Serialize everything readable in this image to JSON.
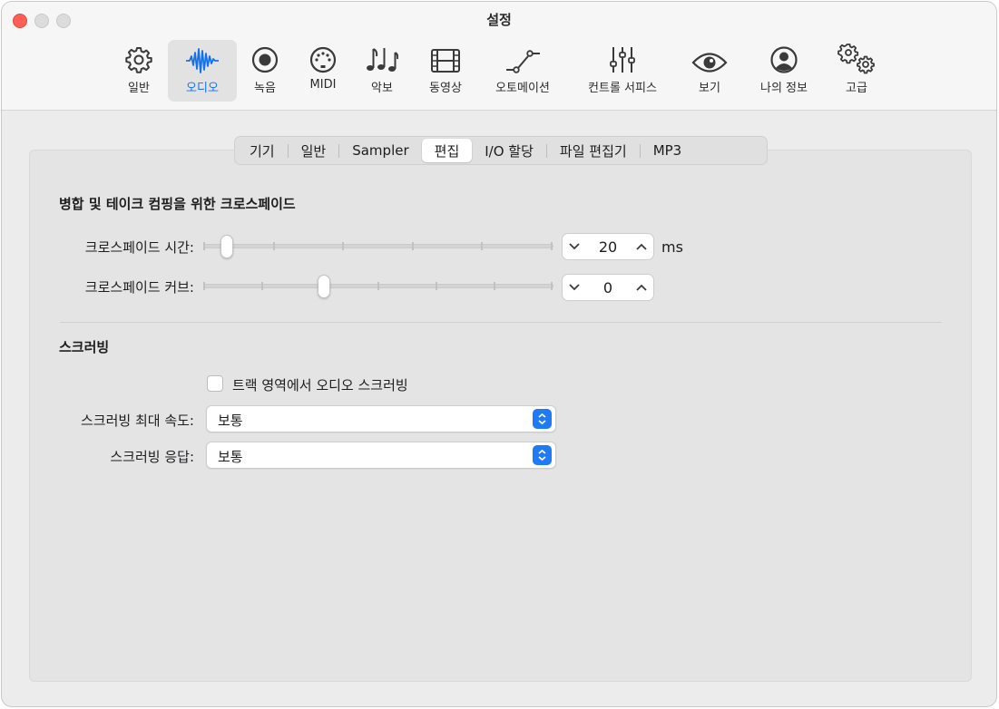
{
  "window": {
    "title": "설정"
  },
  "toolbar": {
    "items": [
      {
        "label": "일반",
        "icon": "gear-icon",
        "active": false
      },
      {
        "label": "오디오",
        "icon": "waveform-icon",
        "active": true
      },
      {
        "label": "녹음",
        "icon": "record-icon",
        "active": false
      },
      {
        "label": "MIDI",
        "icon": "midi-port-icon",
        "active": false
      },
      {
        "label": "악보",
        "icon": "music-notes-icon",
        "active": false
      },
      {
        "label": "동영상",
        "icon": "film-strip-icon",
        "active": false
      },
      {
        "label": "오토메이션",
        "icon": "automation-curve-icon",
        "active": false
      },
      {
        "label": "컨트롤 서피스",
        "icon": "faders-icon",
        "active": false
      },
      {
        "label": "보기",
        "icon": "eye-icon",
        "active": false
      },
      {
        "label": "나의 정보",
        "icon": "person-circle-icon",
        "active": false
      },
      {
        "label": "고급",
        "icon": "gears-icon",
        "active": false
      }
    ],
    "accent_color": "#1572e6"
  },
  "tabs": {
    "items": [
      "기기",
      "일반",
      "Sampler",
      "편집",
      "I/O 할당",
      "파일 편집기",
      "MP3"
    ],
    "active": "편집"
  },
  "crossfade": {
    "title": "병합 및 테이크 컴핑을 위한 크로스페이드",
    "time_label": "크로스페이드 시간:",
    "time_value": "20",
    "time_unit": "ms",
    "time_slider_fraction": 0.05,
    "curve_label": "크로스페이드 커브:",
    "curve_value": "0",
    "curve_slider_fraction": 0.34
  },
  "scrubbing": {
    "title": "스크러빙",
    "checkbox_label": "트랙 영역에서 오디오 스크러빙",
    "checkbox_checked": false,
    "max_speed_label": "스크러빙 최대 속도:",
    "max_speed_value": "보통",
    "response_label": "스크러빙 응답:",
    "response_value": "보통",
    "popup_color": "#1f7bf5"
  }
}
